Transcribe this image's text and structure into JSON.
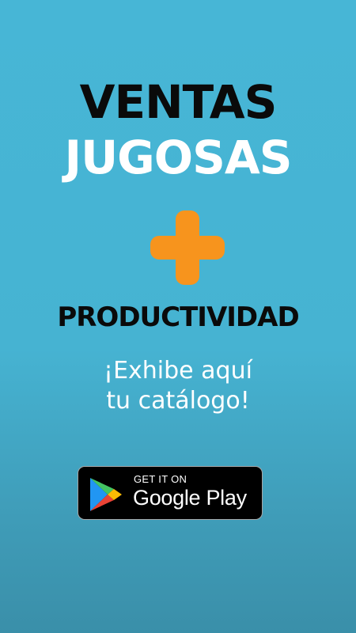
{
  "headline": {
    "line1": "VENTAS",
    "line2": "JUGOSAS",
    "line3": "PRODUCTIVIDAD"
  },
  "plus_icon": {
    "name": "plus-icon",
    "color": "#f7941d"
  },
  "subtitle": {
    "line1": "¡Exhibe aquí",
    "line2": "tu catálogo!"
  },
  "store_badge": {
    "small_text": "GET IT ON",
    "big_text": "Google Play",
    "icon": "google-play-icon"
  },
  "colors": {
    "background": "#47b6d6",
    "headline_dark": "#0a0a0a",
    "headline_light": "#ffffff",
    "accent": "#f7941d"
  }
}
